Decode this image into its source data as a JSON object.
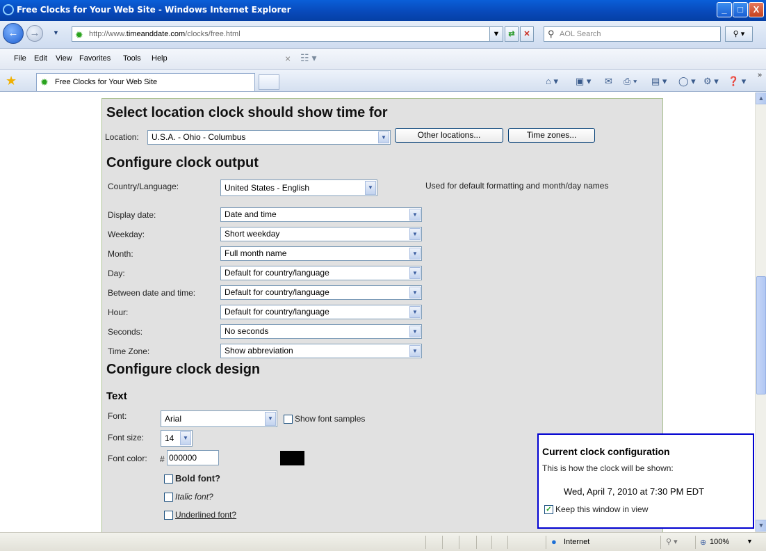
{
  "window": {
    "title": "Free Clocks for Your Web Site - Windows Internet Explorer",
    "minimize": "_",
    "maximize": "□",
    "close": "X"
  },
  "address_bar": {
    "url_prefix": "http://www.",
    "url_domain": "timeanddate.com",
    "url_path": "/clocks/free.html",
    "search_placeholder": "AOL Search"
  },
  "menu": {
    "items": [
      "File",
      "Edit",
      "View",
      "Favorites",
      "Tools",
      "Help"
    ]
  },
  "tab": {
    "title": "Free Clocks for Your Web Site"
  },
  "page": {
    "section_location_title": "Select location clock should show time for",
    "location_label": "Location:",
    "location_value": "U.S.A. - Ohio - Columbus",
    "other_locations_button": "Other locations...",
    "time_zones_button": "Time zones...",
    "section_output_title": "Configure clock output",
    "country_language_label": "Country/Language:",
    "country_language_value": "United States - English",
    "country_language_note": "Used for default formatting and month/day names",
    "rows": [
      {
        "label": "Display date:",
        "value": "Date and time"
      },
      {
        "label": "Weekday:",
        "value": "Short weekday"
      },
      {
        "label": "Month:",
        "value": "Full month name"
      },
      {
        "label": "Day:",
        "value": "Default for country/language"
      },
      {
        "label": "Between date and time:",
        "value": "Default for country/language"
      },
      {
        "label": "Hour:",
        "value": "Default for country/language"
      },
      {
        "label": "Seconds:",
        "value": "No seconds"
      },
      {
        "label": "Time Zone:",
        "value": "Show abbreviation"
      }
    ],
    "section_design_title": "Configure clock design",
    "text_subtitle": "Text",
    "font_label": "Font:",
    "font_value": "Arial",
    "show_font_samples_label": "Show font samples",
    "font_size_label": "Font size:",
    "font_size_value": "14",
    "font_color_label": "Font color:",
    "font_color_hash": "#",
    "font_color_value": "000000",
    "font_color_swatch": "#000000",
    "bold_label": "Bold font?",
    "italic_label": "Italic font?",
    "underline_label": "Underlined font?"
  },
  "clock_box": {
    "title": "Current clock configuration",
    "subtitle": "This is how the clock will be shown:",
    "preview": "Wed, April 7, 2010 at 7:30 PM EDT",
    "keep_in_view_label": "Keep this window in view",
    "keep_in_view_checked": true
  },
  "status_bar": {
    "zone": "Internet",
    "zoom": "100%"
  }
}
